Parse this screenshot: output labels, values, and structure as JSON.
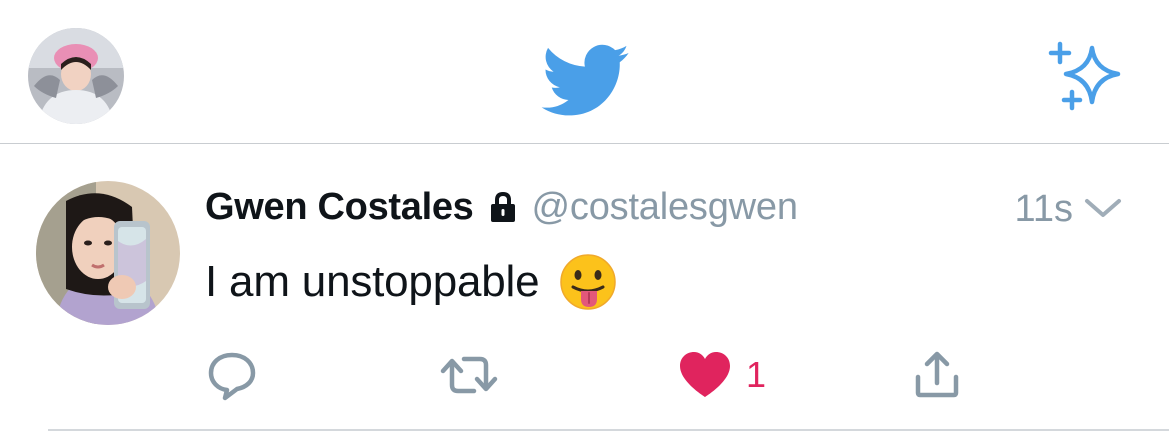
{
  "header": {
    "profile_avatar": "user-avatar",
    "logo_icon": "twitter-bird-icon",
    "sparkle_icon": "sparkle-icon",
    "accent_color": "#4a9fe8"
  },
  "tweet": {
    "author_name": "Gwen Costales",
    "protected_icon": "lock-icon",
    "handle": "@costalesgwen",
    "time": "11s",
    "text": "I am unstoppable",
    "emoji": "face-with-tongue",
    "actions": {
      "reply_icon": "reply-icon",
      "retweet_icon": "retweet-icon",
      "like_icon": "heart-icon",
      "like_count": "1",
      "like_color": "#e0245e",
      "share_icon": "share-icon"
    }
  }
}
